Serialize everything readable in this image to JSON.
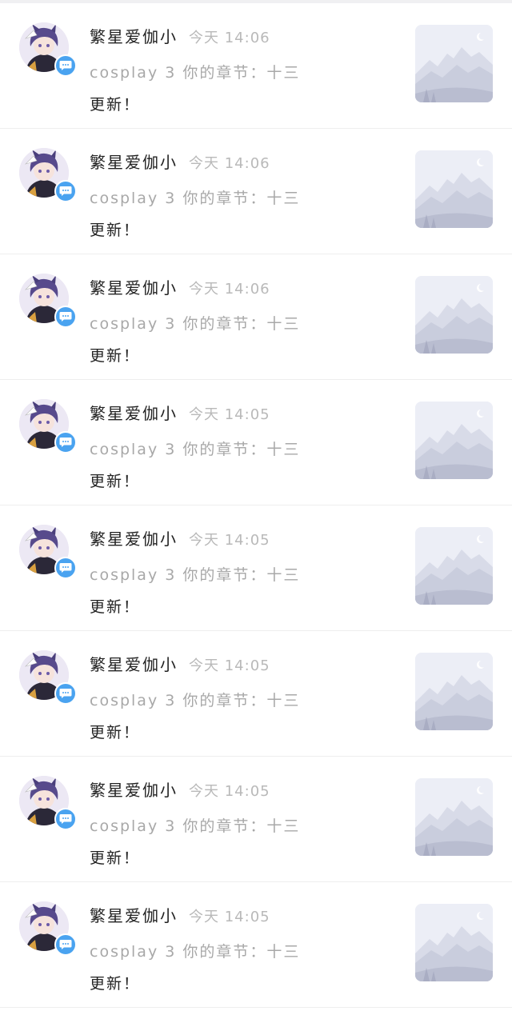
{
  "colors": {
    "badge": "#4aa3f0",
    "name_text": "#222222",
    "muted_text": "#a8a8a8",
    "time_text": "#b9b9b9",
    "divider": "#eeeeee",
    "thumbnail_bg": "#eceef6"
  },
  "notifications": [
    {
      "name": "繁星爱伽小",
      "time": "今天 14:06",
      "message_line1": "cosplay 3 你的章节：十三",
      "message_line2": "更新！",
      "avatar_icon": "anime-avatar-icon",
      "badge_icon": "chat-bubble-icon",
      "thumbnail_icon": "mountain-placeholder-icon"
    },
    {
      "name": "繁星爱伽小",
      "time": "今天 14:06",
      "message_line1": "cosplay 3 你的章节：十三",
      "message_line2": "更新！",
      "avatar_icon": "anime-avatar-icon",
      "badge_icon": "chat-bubble-icon",
      "thumbnail_icon": "mountain-placeholder-icon"
    },
    {
      "name": "繁星爱伽小",
      "time": "今天 14:06",
      "message_line1": "cosplay 3 你的章节：十三",
      "message_line2": "更新！",
      "avatar_icon": "anime-avatar-icon",
      "badge_icon": "chat-bubble-icon",
      "thumbnail_icon": "mountain-placeholder-icon"
    },
    {
      "name": "繁星爱伽小",
      "time": "今天 14:05",
      "message_line1": "cosplay 3 你的章节：十三",
      "message_line2": "更新！",
      "avatar_icon": "anime-avatar-icon",
      "badge_icon": "chat-bubble-icon",
      "thumbnail_icon": "mountain-placeholder-icon"
    },
    {
      "name": "繁星爱伽小",
      "time": "今天 14:05",
      "message_line1": "cosplay 3 你的章节：十三",
      "message_line2": "更新！",
      "avatar_icon": "anime-avatar-icon",
      "badge_icon": "chat-bubble-icon",
      "thumbnail_icon": "mountain-placeholder-icon"
    },
    {
      "name": "繁星爱伽小",
      "time": "今天 14:05",
      "message_line1": "cosplay 3 你的章节：十三",
      "message_line2": "更新！",
      "avatar_icon": "anime-avatar-icon",
      "badge_icon": "chat-bubble-icon",
      "thumbnail_icon": "mountain-placeholder-icon"
    },
    {
      "name": "繁星爱伽小",
      "time": "今天 14:05",
      "message_line1": "cosplay 3 你的章节：十三",
      "message_line2": "更新！",
      "avatar_icon": "anime-avatar-icon",
      "badge_icon": "chat-bubble-icon",
      "thumbnail_icon": "mountain-placeholder-icon"
    },
    {
      "name": "繁星爱伽小",
      "time": "今天 14:05",
      "message_line1": "cosplay 3 你的章节：十三",
      "message_line2": "更新！",
      "avatar_icon": "anime-avatar-icon",
      "badge_icon": "chat-bubble-icon",
      "thumbnail_icon": "mountain-placeholder-icon"
    }
  ]
}
